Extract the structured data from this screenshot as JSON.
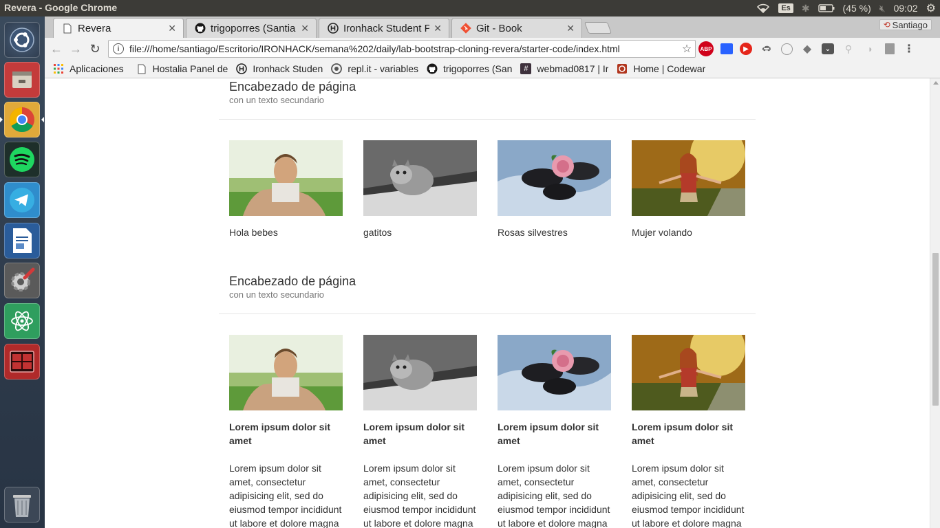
{
  "os": {
    "window_title": "Revera - Google Chrome",
    "keyboard_layout": "Es",
    "battery": "(45 %)",
    "clock": "09:02",
    "launcher_items": [
      "ubuntu-dash-icon",
      "files-icon",
      "chrome-icon",
      "spotify-icon",
      "telegram-icon",
      "libreoffice-writer-icon",
      "system-settings-icon",
      "atom-icon",
      "terminal-icon",
      "trash-icon"
    ]
  },
  "browser": {
    "tabs": [
      {
        "label": "Revera",
        "icon": "page-icon",
        "active": true
      },
      {
        "label": "trigoporres (Santia",
        "icon": "github-icon",
        "active": false
      },
      {
        "label": "Ironhack Student P",
        "icon": "ironhack-icon",
        "active": false
      },
      {
        "label": "Git - Book",
        "icon": "git-icon",
        "active": false
      }
    ],
    "profile_name": "Santiago",
    "url": "file:///home/santiago/Escritorio/IRONHACK/semana%202/daily/lab-bootstrap-cloning-revera/starter-code/index.html",
    "extensions": [
      "ABP",
      "cast",
      "rec",
      "car",
      "circle",
      "layers",
      "pocket",
      "tree",
      "feather",
      "box"
    ],
    "bookmarks": [
      {
        "label": "Aplicaciones",
        "icon": "apps-grid-icon"
      },
      {
        "label": "Hostalia Panel de",
        "icon": "page-icon"
      },
      {
        "label": "Ironhack Studen",
        "icon": "ironhack-icon"
      },
      {
        "label": "repl.it - variables",
        "icon": "replit-icon"
      },
      {
        "label": "trigoporres (San",
        "icon": "github-icon"
      },
      {
        "label": "webmad0817 | Ir",
        "icon": "slack-icon"
      },
      {
        "label": "Home | Codewar",
        "icon": "codewars-icon"
      }
    ]
  },
  "page": {
    "section1": {
      "title": "Encabezado de página",
      "subtitle": "con un texto secundario",
      "cards": [
        {
          "image": "man-pushups-photo",
          "caption": "Hola bebes"
        },
        {
          "image": "kitten-photo",
          "caption": "gatitos"
        },
        {
          "image": "rose-stones-photo",
          "caption": "Rosas silvestres"
        },
        {
          "image": "woman-sunlight-photo",
          "caption": "Mujer volando"
        }
      ]
    },
    "section2": {
      "title": "Encabezado de página",
      "subtitle": "con un texto secundario",
      "cards": [
        {
          "image": "man-pushups-photo",
          "heading_line1": "Lorem ipsum dolor sit",
          "heading_line2": "amet",
          "body": [
            "Lorem ipsum dolor sit",
            "amet, consectetur",
            "adipisicing elit, sed do",
            "eiusmod tempor incididunt",
            "ut labore et dolore magna"
          ]
        },
        {
          "image": "kitten-photo",
          "heading_line1": "Lorem ipsum dolor sit",
          "heading_line2": "amet",
          "body": [
            "Lorem ipsum dolor sit",
            "amet, consectetur",
            "adipisicing elit, sed do",
            "eiusmod tempor incididunt",
            "ut labore et dolore magna"
          ]
        },
        {
          "image": "rose-stones-photo",
          "heading_line1": "Lorem ipsum dolor sit",
          "heading_line2": "amet",
          "body": [
            "Lorem ipsum dolor sit",
            "amet, consectetur",
            "adipisicing elit, sed do",
            "eiusmod tempor incididunt",
            "ut labore et dolore magna"
          ]
        },
        {
          "image": "woman-sunlight-photo",
          "heading_line1": "Lorem ipsum dolor sit",
          "heading_line2": "amet",
          "body": [
            "Lorem ipsum dolor sit",
            "amet, consectetur",
            "adipisicing elit, sed do",
            "eiusmod tempor incididunt",
            "ut labore et dolore magna"
          ]
        }
      ]
    }
  }
}
